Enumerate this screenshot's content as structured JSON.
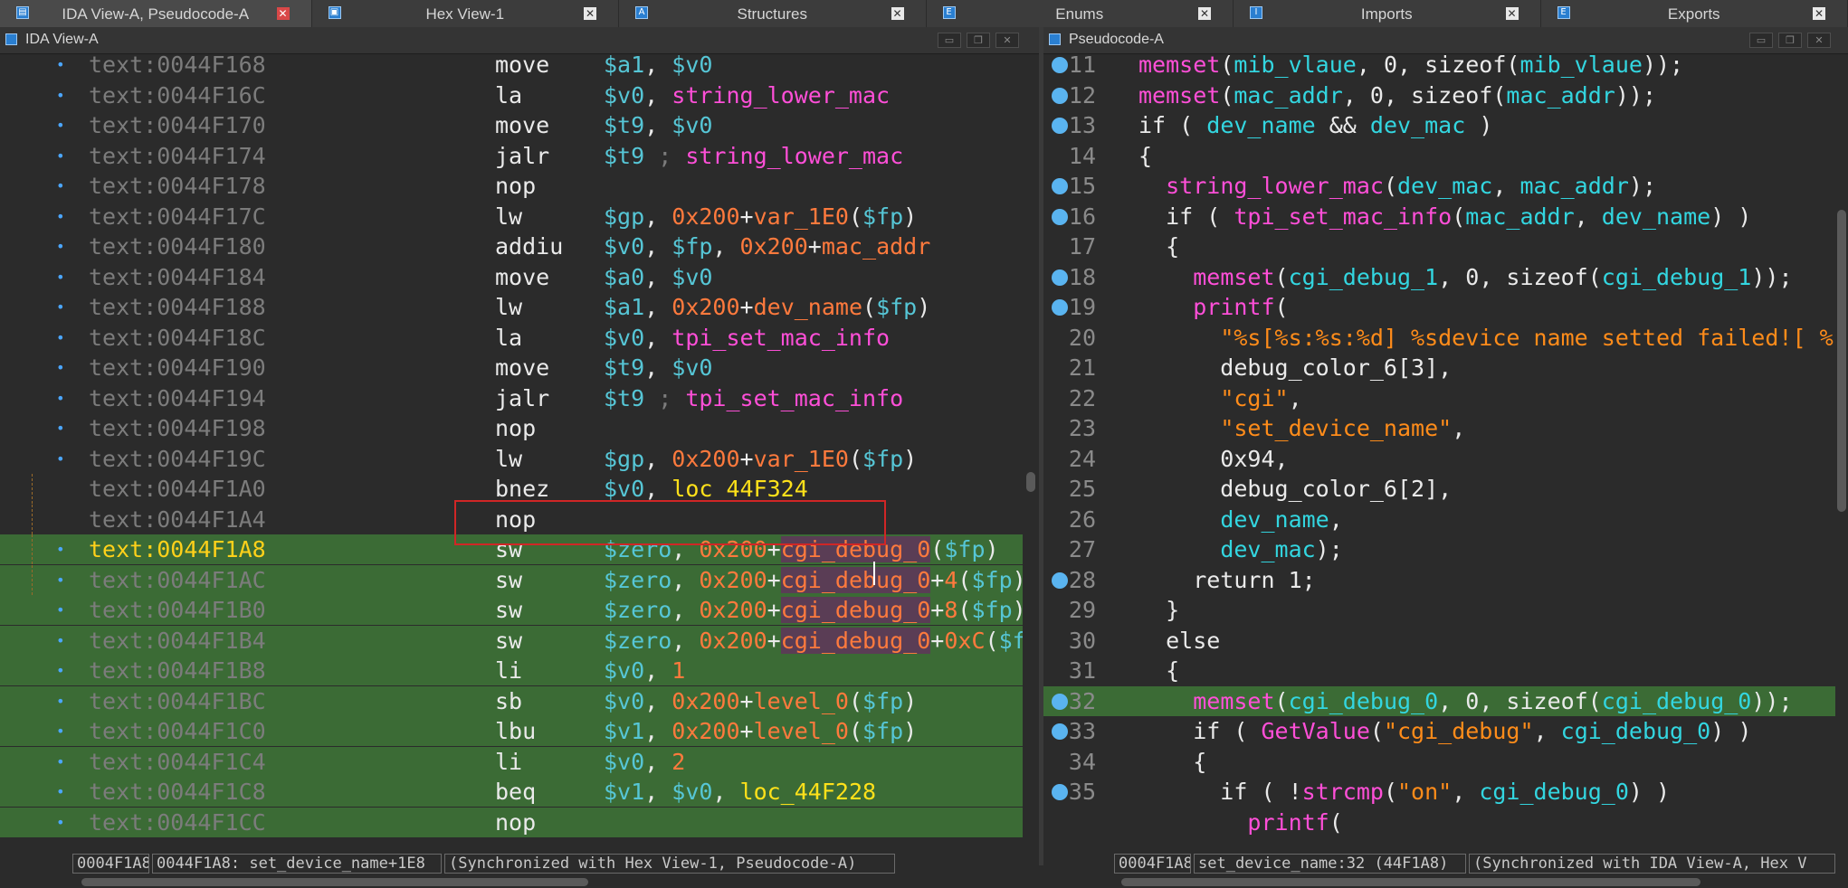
{
  "tabs": [
    {
      "label": "IDA View-A, Pseudocode-A",
      "icon": "ida-view-icon",
      "active": true
    },
    {
      "label": "Hex View-1",
      "icon": "hex-view-icon",
      "active": false
    },
    {
      "label": "Structures",
      "icon": "structures-icon",
      "active": false
    },
    {
      "label": "Enums",
      "icon": "enums-icon",
      "active": false
    },
    {
      "label": "Imports",
      "icon": "imports-icon",
      "active": false
    },
    {
      "label": "Exports",
      "icon": "exports-icon",
      "active": false
    }
  ],
  "left_panel": {
    "title": "IDA View-A",
    "rows": [
      {
        "addr": "text:0044F168",
        "mn": "move",
        "ops": [
          [
            "$a1",
            "reg"
          ],
          [
            ", ",
            "pl"
          ],
          [
            "$v0",
            "reg"
          ]
        ]
      },
      {
        "addr": "text:0044F16C",
        "mn": "la",
        "ops": [
          [
            "$v0",
            "reg"
          ],
          [
            ", ",
            "pl"
          ],
          [
            "string_lower_mac",
            "sym"
          ]
        ]
      },
      {
        "addr": "text:0044F170",
        "mn": "move",
        "ops": [
          [
            "$t9",
            "reg"
          ],
          [
            ", ",
            "pl"
          ],
          [
            "$v0",
            "reg"
          ]
        ]
      },
      {
        "addr": "text:0044F174",
        "mn": "jalr",
        "ops": [
          [
            "$t9",
            "reg"
          ],
          [
            " ; ",
            "cm"
          ],
          [
            "string_lower_mac",
            "sym"
          ]
        ]
      },
      {
        "addr": "text:0044F178",
        "mn": "nop",
        "ops": []
      },
      {
        "addr": "text:0044F17C",
        "mn": "lw",
        "ops": [
          [
            "$gp",
            "reg"
          ],
          [
            ", ",
            "pl"
          ],
          [
            "0x200",
            "num"
          ],
          [
            "+",
            "pl"
          ],
          [
            "var_1E0",
            "var"
          ],
          [
            "(",
            "pl"
          ],
          [
            "$fp",
            "reg"
          ],
          [
            ")",
            "pl"
          ]
        ]
      },
      {
        "addr": "text:0044F180",
        "mn": "addiu",
        "ops": [
          [
            "$v0",
            "reg"
          ],
          [
            ", ",
            "pl"
          ],
          [
            "$fp",
            "reg"
          ],
          [
            ", ",
            "pl"
          ],
          [
            "0x200",
            "num"
          ],
          [
            "+",
            "pl"
          ],
          [
            "mac_addr",
            "var"
          ]
        ]
      },
      {
        "addr": "text:0044F184",
        "mn": "move",
        "ops": [
          [
            "$a0",
            "reg"
          ],
          [
            ", ",
            "pl"
          ],
          [
            "$v0",
            "reg"
          ]
        ]
      },
      {
        "addr": "text:0044F188",
        "mn": "lw",
        "ops": [
          [
            "$a1",
            "reg"
          ],
          [
            ", ",
            "pl"
          ],
          [
            "0x200",
            "num"
          ],
          [
            "+",
            "pl"
          ],
          [
            "dev_name",
            "var"
          ],
          [
            "(",
            "pl"
          ],
          [
            "$fp",
            "reg"
          ],
          [
            ")",
            "pl"
          ]
        ]
      },
      {
        "addr": "text:0044F18C",
        "mn": "la",
        "ops": [
          [
            "$v0",
            "reg"
          ],
          [
            ", ",
            "pl"
          ],
          [
            "tpi_set_mac_info",
            "sym"
          ]
        ]
      },
      {
        "addr": "text:0044F190",
        "mn": "move",
        "ops": [
          [
            "$t9",
            "reg"
          ],
          [
            ", ",
            "pl"
          ],
          [
            "$v0",
            "reg"
          ]
        ]
      },
      {
        "addr": "text:0044F194",
        "mn": "jalr",
        "ops": [
          [
            "$t9",
            "reg"
          ],
          [
            " ; ",
            "cm"
          ],
          [
            "tpi_set_mac_info",
            "sym"
          ]
        ]
      },
      {
        "addr": "text:0044F198",
        "mn": "nop",
        "ops": []
      },
      {
        "addr": "text:0044F19C",
        "mn": "lw",
        "ops": [
          [
            "$gp",
            "reg"
          ],
          [
            ", ",
            "pl"
          ],
          [
            "0x200",
            "num"
          ],
          [
            "+",
            "pl"
          ],
          [
            "var_1E0",
            "var"
          ],
          [
            "(",
            "pl"
          ],
          [
            "$fp",
            "reg"
          ],
          [
            ")",
            "pl"
          ]
        ]
      },
      {
        "addr": "text:0044F1A0",
        "mn": "bnez",
        "ops": [
          [
            "$v0",
            "reg"
          ],
          [
            ", ",
            "pl"
          ],
          [
            "loc_44F324",
            "loc"
          ]
        ]
      },
      {
        "addr": "text:0044F1A4",
        "mn": "nop",
        "ops": []
      },
      {
        "addr": "text:0044F1A8",
        "mn": "sw",
        "ops": [
          [
            "$zero",
            "reg"
          ],
          [
            ", ",
            "pl"
          ],
          [
            "0x200",
            "num"
          ],
          [
            "+",
            "pl"
          ],
          [
            "cgi_debug_0",
            "varsel"
          ],
          [
            "(",
            "pl"
          ],
          [
            "$fp",
            "reg"
          ],
          [
            ")",
            "pl"
          ]
        ]
      },
      {
        "addr": "text:0044F1AC",
        "mn": "sw",
        "ops": [
          [
            "$zero",
            "reg"
          ],
          [
            ", ",
            "pl"
          ],
          [
            "0x200",
            "num"
          ],
          [
            "+",
            "pl"
          ],
          [
            "cgi_debug_0",
            "varsel"
          ],
          [
            "+",
            "pl"
          ],
          [
            "4",
            "num"
          ],
          [
            "(",
            "pl"
          ],
          [
            "$fp",
            "reg"
          ],
          [
            ")",
            "pl"
          ]
        ]
      },
      {
        "addr": "text:0044F1B0",
        "mn": "sw",
        "ops": [
          [
            "$zero",
            "reg"
          ],
          [
            ", ",
            "pl"
          ],
          [
            "0x200",
            "num"
          ],
          [
            "+",
            "pl"
          ],
          [
            "cgi_debug_0",
            "varsel"
          ],
          [
            "+",
            "pl"
          ],
          [
            "8",
            "num"
          ],
          [
            "(",
            "pl"
          ],
          [
            "$fp",
            "reg"
          ],
          [
            ")",
            "pl"
          ]
        ]
      },
      {
        "addr": "text:0044F1B4",
        "mn": "sw",
        "ops": [
          [
            "$zero",
            "reg"
          ],
          [
            ", ",
            "pl"
          ],
          [
            "0x200",
            "num"
          ],
          [
            "+",
            "pl"
          ],
          [
            "cgi_debug_0",
            "varsel"
          ],
          [
            "+",
            "pl"
          ],
          [
            "0xC",
            "num"
          ],
          [
            "(",
            "pl"
          ],
          [
            "$f",
            "reg"
          ]
        ]
      },
      {
        "addr": "text:0044F1B8",
        "mn": "li",
        "ops": [
          [
            "$v0",
            "reg"
          ],
          [
            ", ",
            "pl"
          ],
          [
            "1",
            "num"
          ]
        ]
      },
      {
        "addr": "text:0044F1BC",
        "mn": "sb",
        "ops": [
          [
            "$v0",
            "reg"
          ],
          [
            ", ",
            "pl"
          ],
          [
            "0x200",
            "num"
          ],
          [
            "+",
            "pl"
          ],
          [
            "level_0",
            "var"
          ],
          [
            "(",
            "pl"
          ],
          [
            "$fp",
            "reg"
          ],
          [
            ")",
            "pl"
          ]
        ]
      },
      {
        "addr": "text:0044F1C0",
        "mn": "lbu",
        "ops": [
          [
            "$v1",
            "reg"
          ],
          [
            ", ",
            "pl"
          ],
          [
            "0x200",
            "num"
          ],
          [
            "+",
            "pl"
          ],
          [
            "level_0",
            "var"
          ],
          [
            "(",
            "pl"
          ],
          [
            "$fp",
            "reg"
          ],
          [
            ")",
            "pl"
          ]
        ]
      },
      {
        "addr": "text:0044F1C4",
        "mn": "li",
        "ops": [
          [
            "$v0",
            "reg"
          ],
          [
            ", ",
            "pl"
          ],
          [
            "2",
            "num"
          ]
        ]
      },
      {
        "addr": "text:0044F1C8",
        "mn": "beq",
        "ops": [
          [
            "$v1",
            "reg"
          ],
          [
            ", ",
            "pl"
          ],
          [
            "$v0",
            "reg"
          ],
          [
            ", ",
            "pl"
          ],
          [
            "loc_44F228",
            "loc"
          ]
        ]
      },
      {
        "addr": "text:0044F1CC",
        "mn": "nop",
        "ops": []
      }
    ],
    "status": [
      "0004F1A8",
      "0044F1A8: set_device_name+1E8",
      "(Synchronized with Hex View-1, Pseudocode-A)"
    ]
  },
  "right_panel": {
    "title": "Pseudocode-A",
    "rows": [
      {
        "ln": "11",
        "bp": true,
        "code": [
          [
            "memset",
            "fn"
          ],
          [
            "(",
            "pl"
          ],
          [
            "mib_vlaue",
            "var"
          ],
          [
            ", 0, sizeof(",
            "pl"
          ],
          [
            "mib_vlaue",
            "var"
          ],
          [
            "));",
            "pl"
          ]
        ]
      },
      {
        "ln": "12",
        "bp": true,
        "code": [
          [
            "memset",
            "fn"
          ],
          [
            "(",
            "pl"
          ],
          [
            "mac_addr",
            "var"
          ],
          [
            ", 0, sizeof(",
            "pl"
          ],
          [
            "mac_addr",
            "var"
          ],
          [
            "));",
            "pl"
          ]
        ]
      },
      {
        "ln": "13",
        "bp": true,
        "code": [
          [
            "if ( ",
            "pl"
          ],
          [
            "dev_name",
            "var"
          ],
          [
            " && ",
            "pl"
          ],
          [
            "dev_mac",
            "var"
          ],
          [
            " )",
            "pl"
          ]
        ]
      },
      {
        "ln": "14",
        "bp": false,
        "code": [
          [
            "{",
            "pl"
          ]
        ]
      },
      {
        "ln": "15",
        "bp": true,
        "code": [
          [
            "  ",
            "pl"
          ],
          [
            "string_lower_mac",
            "fn"
          ],
          [
            "(",
            "pl"
          ],
          [
            "dev_mac",
            "var"
          ],
          [
            ", ",
            "pl"
          ],
          [
            "mac_addr",
            "var"
          ],
          [
            ");",
            "pl"
          ]
        ]
      },
      {
        "ln": "16",
        "bp": true,
        "code": [
          [
            "  if ( ",
            "pl"
          ],
          [
            "tpi_set_mac_info",
            "fn"
          ],
          [
            "(",
            "pl"
          ],
          [
            "mac_addr",
            "var"
          ],
          [
            ", ",
            "pl"
          ],
          [
            "dev_name",
            "var"
          ],
          [
            ") )",
            "pl"
          ]
        ]
      },
      {
        "ln": "17",
        "bp": false,
        "code": [
          [
            "  {",
            "pl"
          ]
        ]
      },
      {
        "ln": "18",
        "bp": true,
        "code": [
          [
            "    ",
            "pl"
          ],
          [
            "memset",
            "fn"
          ],
          [
            "(",
            "pl"
          ],
          [
            "cgi_debug_1",
            "var"
          ],
          [
            ", 0, sizeof(",
            "pl"
          ],
          [
            "cgi_debug_1",
            "var"
          ],
          [
            "));",
            "pl"
          ]
        ]
      },
      {
        "ln": "19",
        "bp": true,
        "code": [
          [
            "    ",
            "pl"
          ],
          [
            "printf",
            "fn"
          ],
          [
            "(",
            "pl"
          ]
        ]
      },
      {
        "ln": "20",
        "bp": false,
        "code": [
          [
            "      ",
            "pl"
          ],
          [
            "\"%s[%s:%s:%d] %sdevice name setted failed![ %",
            "str"
          ]
        ]
      },
      {
        "ln": "21",
        "bp": false,
        "code": [
          [
            "      debug_color_6[3],",
            "pl"
          ]
        ]
      },
      {
        "ln": "22",
        "bp": false,
        "code": [
          [
            "      ",
            "pl"
          ],
          [
            "\"cgi\"",
            "str"
          ],
          [
            ",",
            "pl"
          ]
        ]
      },
      {
        "ln": "23",
        "bp": false,
        "code": [
          [
            "      ",
            "pl"
          ],
          [
            "\"set_device_name\"",
            "str"
          ],
          [
            ",",
            "pl"
          ]
        ]
      },
      {
        "ln": "24",
        "bp": false,
        "code": [
          [
            "      0x94,",
            "pl"
          ]
        ]
      },
      {
        "ln": "25",
        "bp": false,
        "code": [
          [
            "      debug_color_6[2],",
            "pl"
          ]
        ]
      },
      {
        "ln": "26",
        "bp": false,
        "code": [
          [
            "      ",
            "pl"
          ],
          [
            "dev_name",
            "var"
          ],
          [
            ",",
            "pl"
          ]
        ]
      },
      {
        "ln": "27",
        "bp": false,
        "code": [
          [
            "      ",
            "pl"
          ],
          [
            "dev_mac",
            "var"
          ],
          [
            ");",
            "pl"
          ]
        ]
      },
      {
        "ln": "28",
        "bp": true,
        "code": [
          [
            "    return 1;",
            "pl"
          ]
        ]
      },
      {
        "ln": "29",
        "bp": false,
        "code": [
          [
            "  }",
            "pl"
          ]
        ]
      },
      {
        "ln": "30",
        "bp": false,
        "code": [
          [
            "  else",
            "pl"
          ]
        ]
      },
      {
        "ln": "31",
        "bp": false,
        "code": [
          [
            "  {",
            "pl"
          ]
        ]
      },
      {
        "ln": "32",
        "bp": true,
        "code": [
          [
            "    ",
            "pl"
          ],
          [
            "memset",
            "fn"
          ],
          [
            "(",
            "pl"
          ],
          [
            "cgi_debug_0",
            "var"
          ],
          [
            ", 0, sizeof(",
            "pl"
          ],
          [
            "cgi_debug_0",
            "var"
          ],
          [
            "));",
            "pl"
          ]
        ]
      },
      {
        "ln": "33",
        "bp": true,
        "code": [
          [
            "    if ( ",
            "pl"
          ],
          [
            "GetValue",
            "fn"
          ],
          [
            "(",
            "pl"
          ],
          [
            "\"cgi_debug\"",
            "str"
          ],
          [
            ", ",
            "pl"
          ],
          [
            "cgi_debug_0",
            "var"
          ],
          [
            ") )",
            "pl"
          ]
        ]
      },
      {
        "ln": "34",
        "bp": false,
        "code": [
          [
            "    {",
            "pl"
          ]
        ]
      },
      {
        "ln": "35",
        "bp": true,
        "code": [
          [
            "      if ( !",
            "pl"
          ],
          [
            "strcmp",
            "fn"
          ],
          [
            "(",
            "pl"
          ],
          [
            "\"on\"",
            "str"
          ],
          [
            ", ",
            "pl"
          ],
          [
            "cgi_debug_0",
            "var"
          ],
          [
            ") )",
            "pl"
          ]
        ]
      },
      {
        "ln": "",
        "bp": false,
        "code": [
          [
            "        ",
            "pl"
          ],
          [
            "printf",
            "fn"
          ],
          [
            "(",
            "pl"
          ]
        ]
      }
    ],
    "status": [
      "0004F1A8",
      "set_device_name:32 (44F1A8)",
      "(Synchronized with IDA View-A, Hex V"
    ]
  },
  "colors": {
    "background": "#2b2b2b",
    "highlight_row": "#3b6b35",
    "register": "#56c6d6",
    "symbol": "#ff4fd8",
    "number": "#ff7a3d",
    "location": "#ffe11a",
    "string": "#ff8c1a",
    "selection_box": "#d02626"
  }
}
